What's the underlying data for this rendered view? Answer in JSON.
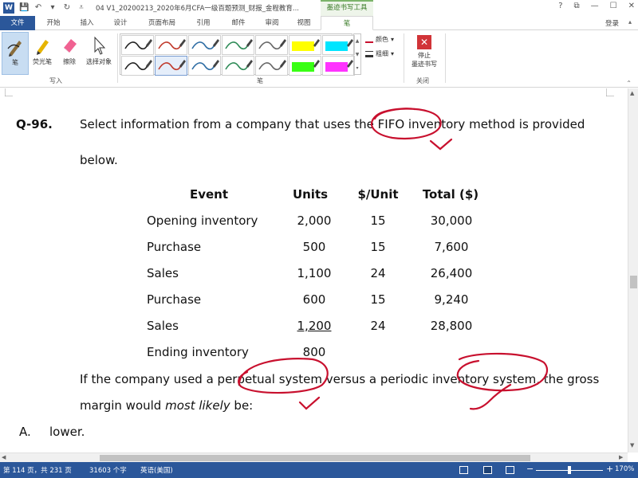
{
  "titlebar": {
    "logo": "W",
    "title": "04 V1_20200213_2020年6月CFA一级百题预测_财报_金程教育...",
    "context_title": "墨迹书写工具",
    "help": "?",
    "restore": "⧉",
    "minimize": "—",
    "maximize": "☐",
    "close": "✕"
  },
  "tabs": [
    {
      "label": "文件"
    },
    {
      "label": "开始"
    },
    {
      "label": "插入"
    },
    {
      "label": "设计"
    },
    {
      "label": "页面布局"
    },
    {
      "label": "引用"
    },
    {
      "label": "邮件"
    },
    {
      "label": "审阅"
    },
    {
      "label": "视图"
    },
    {
      "label": "笔"
    }
  ],
  "login": "登录",
  "ribbon": {
    "write_group": "写入",
    "pen": "笔",
    "highlighter": "荧光笔",
    "eraser": "擦除",
    "select_objects": "选择对象",
    "pens_group": "笔",
    "color": "颜色",
    "thickness": "粗细",
    "close_group": "关闭",
    "stop_inking_1": "停止",
    "stop_inking_2": "墨迹书写",
    "pen_colors": [
      "#222222",
      "#c0392b",
      "#2e6da4",
      "#2e8b57",
      "#666666",
      "#ffff00",
      "#00e5ff",
      "#222222",
      "#c0392b",
      "#2e6da4",
      "#2e8b57",
      "#666666",
      "#39ff14",
      "#ff33ff"
    ]
  },
  "document": {
    "question_no": "Q-96.",
    "stem_line1": "Select information from a company that uses the FIFO inventory method is provided",
    "stem_line2": "below.",
    "table": {
      "headers": [
        "Event",
        "Units",
        "$/Unit",
        "Total ($)"
      ],
      "rows": [
        [
          "Opening inventory",
          "2,000",
          "15",
          "30,000"
        ],
        [
          "Purchase",
          "500",
          "15",
          "7,600"
        ],
        [
          "Sales",
          "1,100",
          "24",
          "26,400"
        ],
        [
          "Purchase",
          "600",
          "15",
          "9,240"
        ],
        [
          "Sales",
          "1,200",
          "24",
          "28,800"
        ],
        [
          "Ending inventory",
          "800",
          "",
          ""
        ]
      ]
    },
    "q_line1": "If the company used a perpetual system versus a periodic inventory system, the gross",
    "q_line2_a": "margin would ",
    "q_line2_b": "most likely",
    "q_line2_c": " be:",
    "option_a_label": "A.",
    "option_a_text": "lower."
  },
  "statusbar": {
    "page": "第 114 页，共 231 页",
    "words": "31603 个字",
    "language": "英语(美国)",
    "zoom_minus": "−",
    "zoom_plus": "+",
    "zoom": "170%"
  },
  "colors": {
    "brand": "#2b579a",
    "context_green": "#3c7d2a",
    "ink_red": "#c8102e"
  }
}
